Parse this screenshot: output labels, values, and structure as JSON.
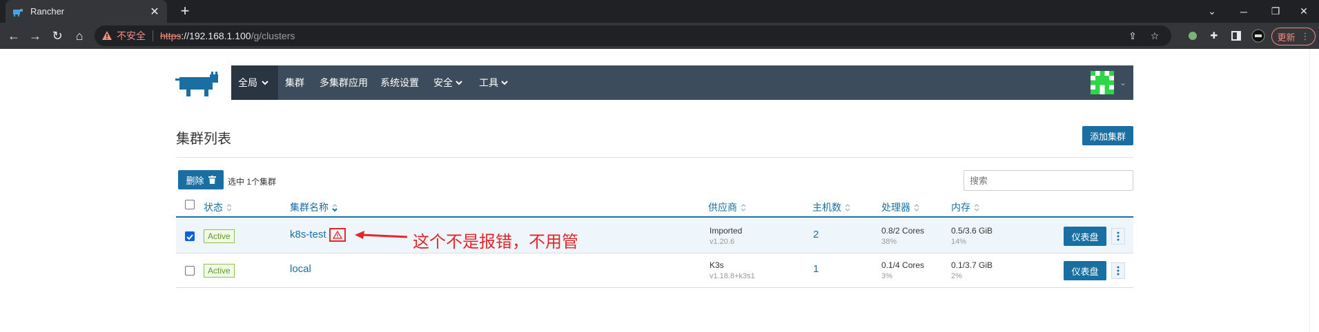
{
  "browser": {
    "tab_title": "Rancher",
    "tab_close": "✕",
    "new_tab": "+",
    "url_insecure_label": "不安全",
    "url_scheme": "https",
    "url_host": "://192.168.1.100",
    "url_path": "/g/clusters",
    "update_label": "更新"
  },
  "nav": {
    "global": "全局",
    "items": [
      "集群",
      "多集群应用",
      "系统设置",
      "安全",
      "工具"
    ]
  },
  "page": {
    "title": "集群列表",
    "add_cluster": "添加集群",
    "delete_label": "删除",
    "selected_text": "选中 1个集群",
    "search_placeholder": "搜索"
  },
  "table": {
    "columns": [
      "状态",
      "集群名称",
      "供应商",
      "主机数",
      "处理器",
      "内存"
    ],
    "rows": [
      {
        "checked": true,
        "status": "Active",
        "name": "k8s-test",
        "provider": "Imported",
        "version": "v1.20.6",
        "hosts": "2",
        "cpu": "0.8/2 Cores",
        "cpu_pct": "38%",
        "mem": "0.5/3.6 GiB",
        "mem_pct": "14%",
        "dashboard": "仪表盘"
      },
      {
        "checked": false,
        "status": "Active",
        "name": "local",
        "provider": "K3s",
        "version": "v1.18.8+k3s1",
        "hosts": "1",
        "cpu": "0.1/4 Cores",
        "cpu_pct": "3%",
        "mem": "0.1/3.7 GiB",
        "mem_pct": "2%",
        "dashboard": "仪表盘"
      }
    ]
  },
  "annotation": {
    "text": "这个不是报错，不用管"
  },
  "colors": {
    "accent": "#1a6fa2",
    "navbar": "#3d4c5c",
    "annotation_red": "#e3262a",
    "active_green": "#5c9b2a"
  }
}
